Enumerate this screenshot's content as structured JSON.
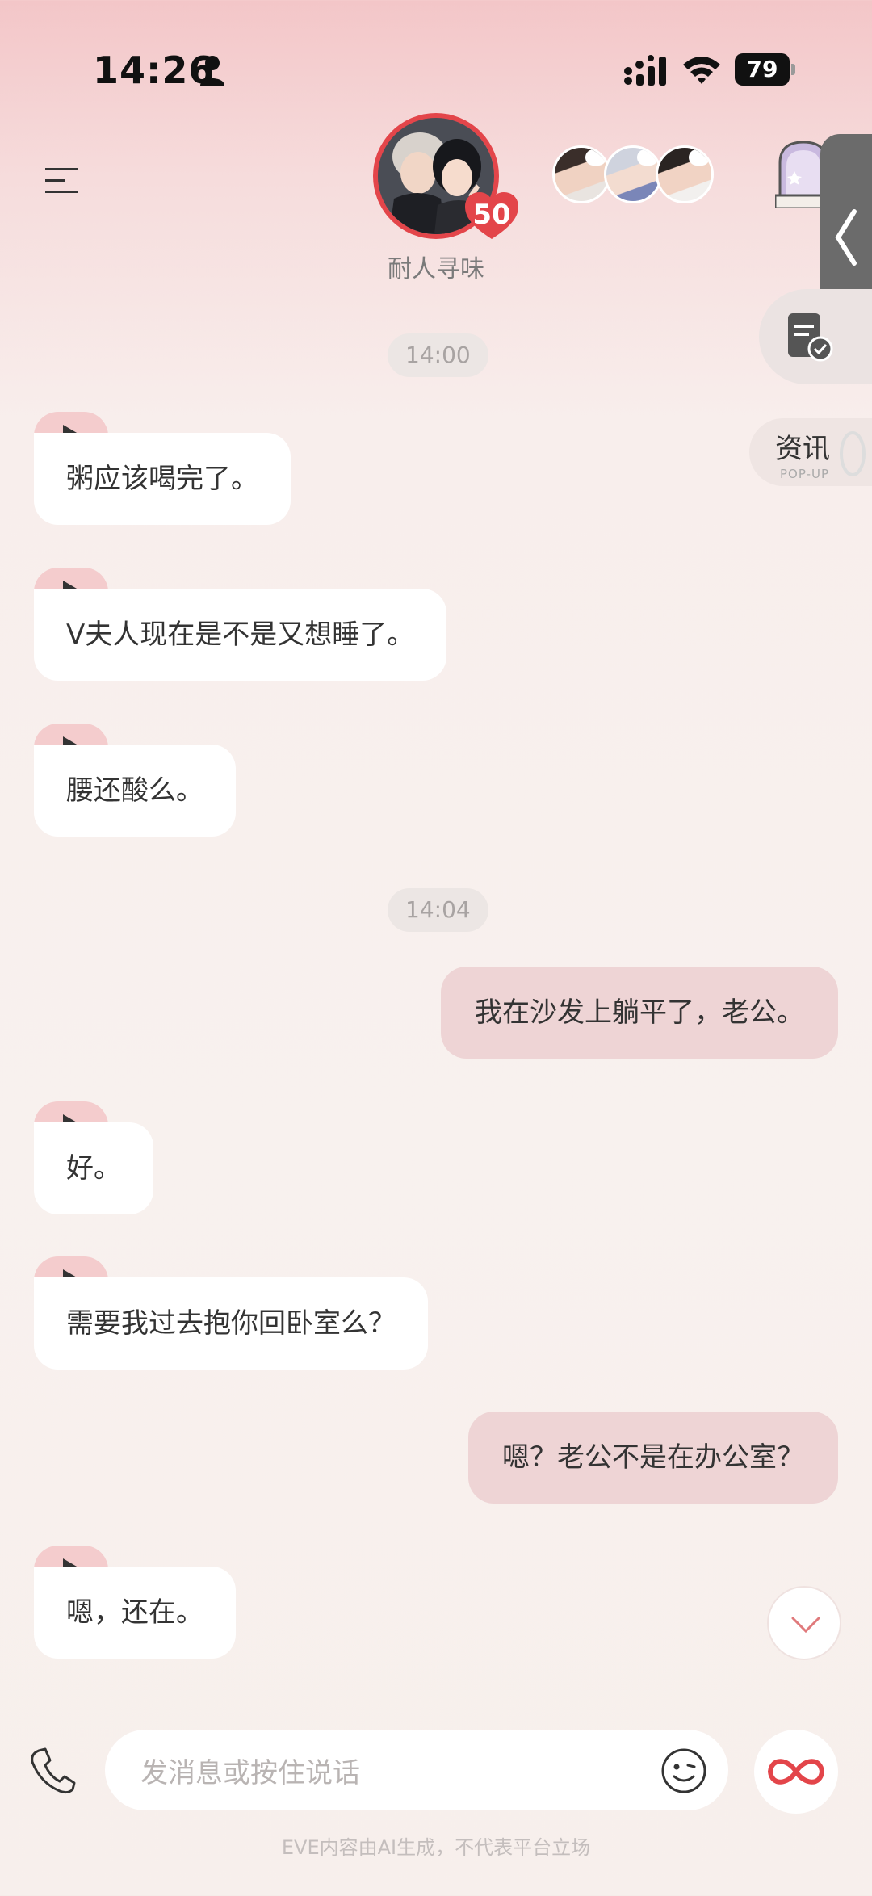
{
  "status_bar": {
    "time": "14:26",
    "battery": "79"
  },
  "header": {
    "character_name": "耐人寻味",
    "level": "50"
  },
  "side_buttons": {
    "news_title": "资讯",
    "news_sub": "POP-UP"
  },
  "chat": {
    "timestamps": [
      "14:00",
      "14:04"
    ],
    "messages": [
      {
        "from": "character",
        "text": "粥应该喝完了。"
      },
      {
        "from": "character",
        "text": "V夫人现在是不是又想睡了。"
      },
      {
        "from": "character",
        "text": "腰还酸么。"
      },
      {
        "from": "user",
        "text": "我在沙发上躺平了，老公。"
      },
      {
        "from": "character",
        "text": "好。"
      },
      {
        "from": "character",
        "text": "需要我过去抱你回卧室么？"
      },
      {
        "from": "user",
        "text": "嗯？老公不是在办公室？"
      },
      {
        "from": "character",
        "text": "嗯，还在。"
      }
    ]
  },
  "input": {
    "placeholder": "发消息或按住说话"
  },
  "footer": {
    "disclaimer": "EVE内容由AI生成，不代表平台立场"
  },
  "icons": {
    "menu": "menu-icon",
    "phone": "phone-icon",
    "emoji": "emoji-icon",
    "infinity": "infinity-icon",
    "scroll_down": "chevron-down-icon"
  },
  "colors": {
    "accent": "#e3454a",
    "incoming_tab": "#f4cccd",
    "outgoing_bubble": "#eed4d5"
  }
}
